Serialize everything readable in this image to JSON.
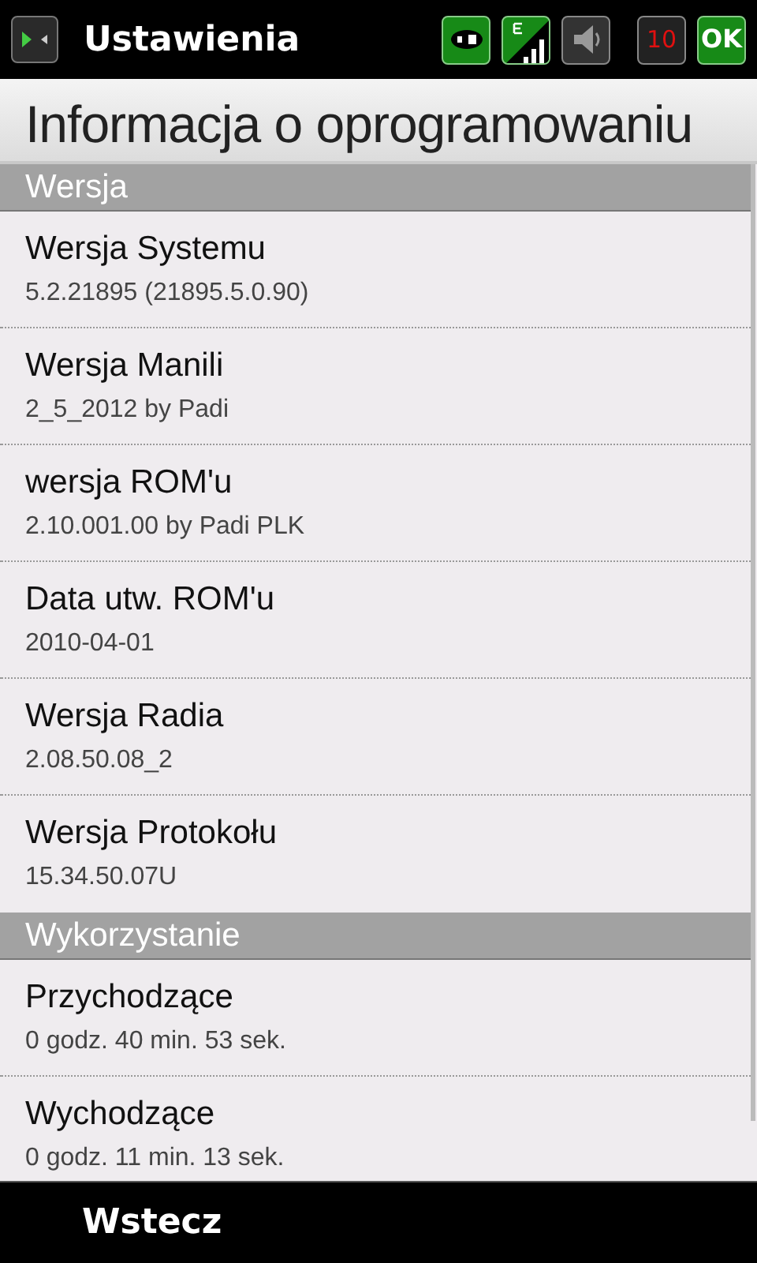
{
  "title_bar": {
    "title": "Ustawienia",
    "battery_badge": "10",
    "ok_button": "OK"
  },
  "page_title": "Informacja o oprogramowaniu",
  "sections": [
    {
      "title": "Wersja",
      "items": [
        {
          "label": "Wersja Systemu",
          "value": "5.2.21895 (21895.5.0.90)"
        },
        {
          "label": "Wersja Manili",
          "value": "2_5_2012 by Padi"
        },
        {
          "label": "wersja ROM'u",
          "value": "2.10.001.00 by Padi PLK"
        },
        {
          "label": "Data utw. ROM'u",
          "value": "2010-04-01"
        },
        {
          "label": "Wersja Radia",
          "value": "2.08.50.08_2"
        },
        {
          "label": "Wersja Protokołu",
          "value": "15.34.50.07U"
        }
      ]
    },
    {
      "title": "Wykorzystanie",
      "items": [
        {
          "label": "Przychodzące",
          "value": "0 godz. 40 min. 53 sek."
        },
        {
          "label": "Wychodzące",
          "value": "0 godz. 11 min. 13 sek."
        }
      ]
    }
  ],
  "soft_key": "Wstecz"
}
